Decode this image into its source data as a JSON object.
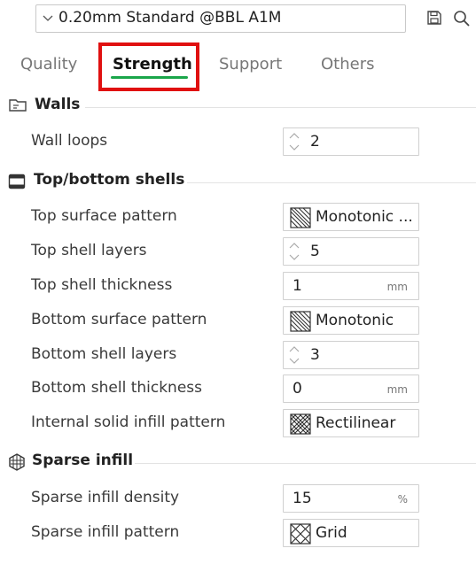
{
  "preset": {
    "name": "0.20mm Standard @BBL A1M"
  },
  "tabs": [
    {
      "label": "Quality"
    },
    {
      "label": "Strength"
    },
    {
      "label": "Support"
    },
    {
      "label": "Others"
    }
  ],
  "sections": {
    "walls": {
      "title": "Walls",
      "wall_loops": {
        "label": "Wall loops",
        "value": "2"
      }
    },
    "shells": {
      "title": "Top/bottom shells",
      "top_pattern": {
        "label": "Top surface pattern",
        "value": "Monotonic ..."
      },
      "top_layers": {
        "label": "Top shell layers",
        "value": "5"
      },
      "top_thickness": {
        "label": "Top shell thickness",
        "value": "1",
        "unit": "mm"
      },
      "bottom_pattern": {
        "label": "Bottom surface pattern",
        "value": "Monotonic"
      },
      "bottom_layers": {
        "label": "Bottom shell layers",
        "value": "3"
      },
      "bottom_thickness": {
        "label": "Bottom shell thickness",
        "value": "0",
        "unit": "mm"
      },
      "internal_pattern": {
        "label": "Internal solid infill pattern",
        "value": "Rectilinear"
      }
    },
    "sparse": {
      "title": "Sparse infill",
      "density": {
        "label": "Sparse infill density",
        "value": "15",
        "unit": "%"
      },
      "pattern": {
        "label": "Sparse infill pattern",
        "value": "Grid"
      }
    }
  },
  "colors": {
    "active_tab_underline": "#1aa64a",
    "highlight_box": "#e01010"
  }
}
